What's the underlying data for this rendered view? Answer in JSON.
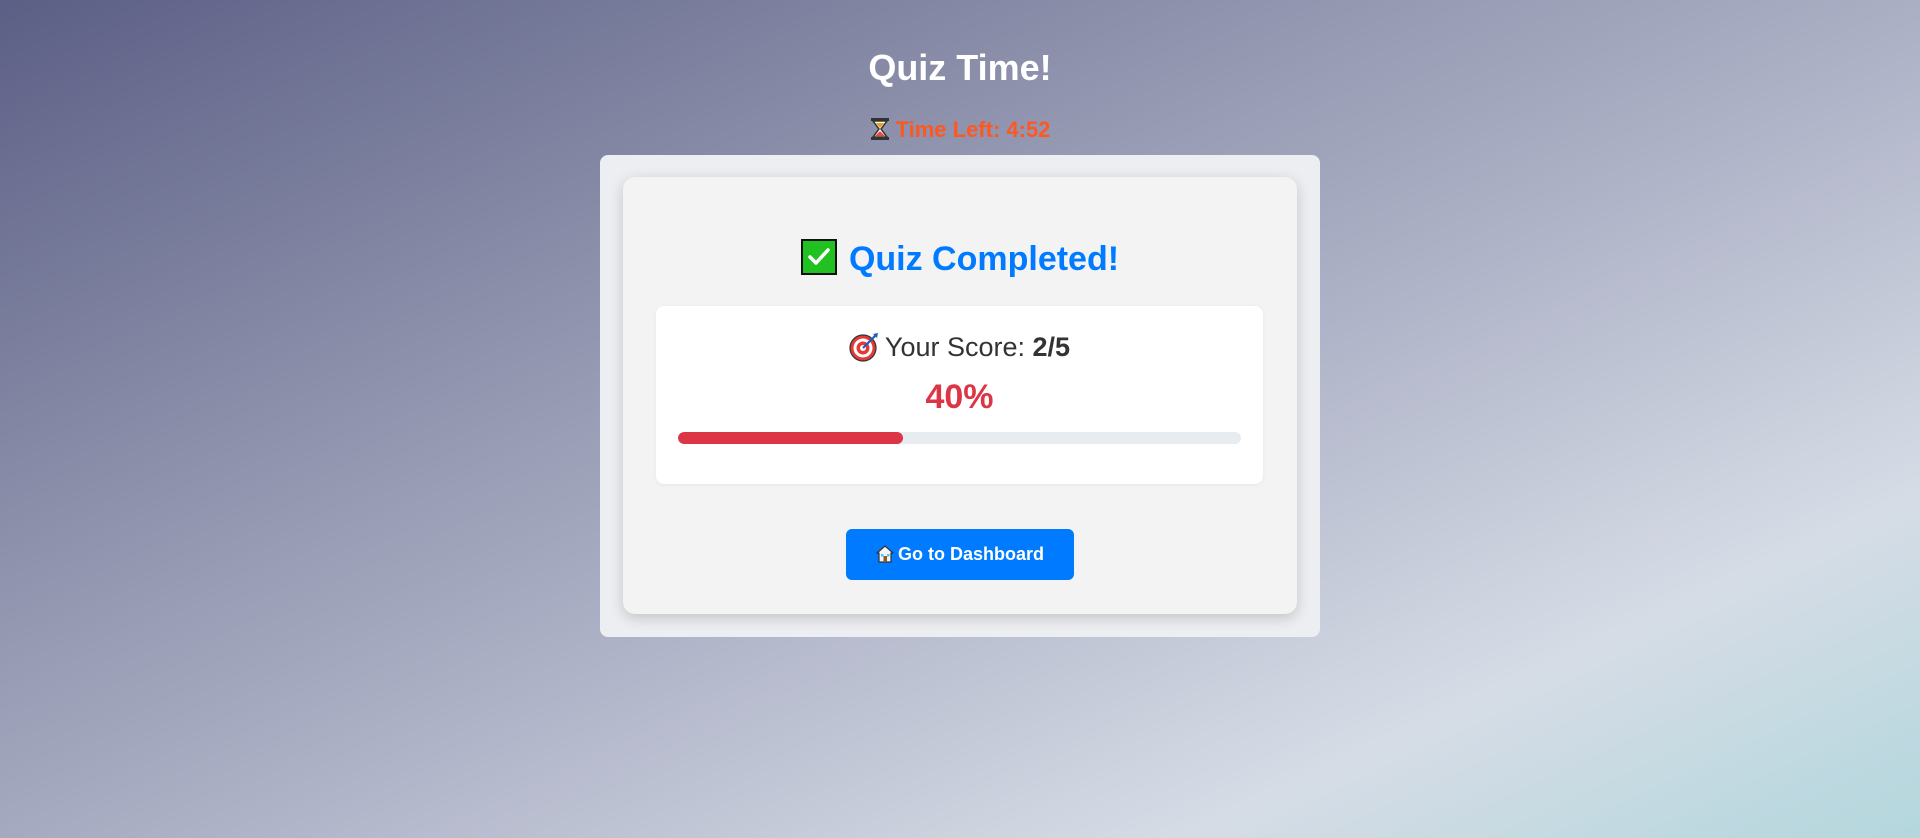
{
  "page": {
    "title": "Quiz Time!"
  },
  "timer": {
    "icon": "hourglass-icon",
    "text": "Time Left: 4:52",
    "color": "#ff5722"
  },
  "result": {
    "check_icon": "check-box-icon",
    "heading": "Quiz Completed!",
    "heading_color": "#007bff",
    "score_icon": "target-icon",
    "score_label": "Your Score: ",
    "score_value": "2/5",
    "percent_text": "40%",
    "percent_value": 40,
    "percent_color": "#dc3545",
    "button_icon": "home-icon",
    "button_label": "Go to Dashboard",
    "button_color": "#007bff"
  }
}
